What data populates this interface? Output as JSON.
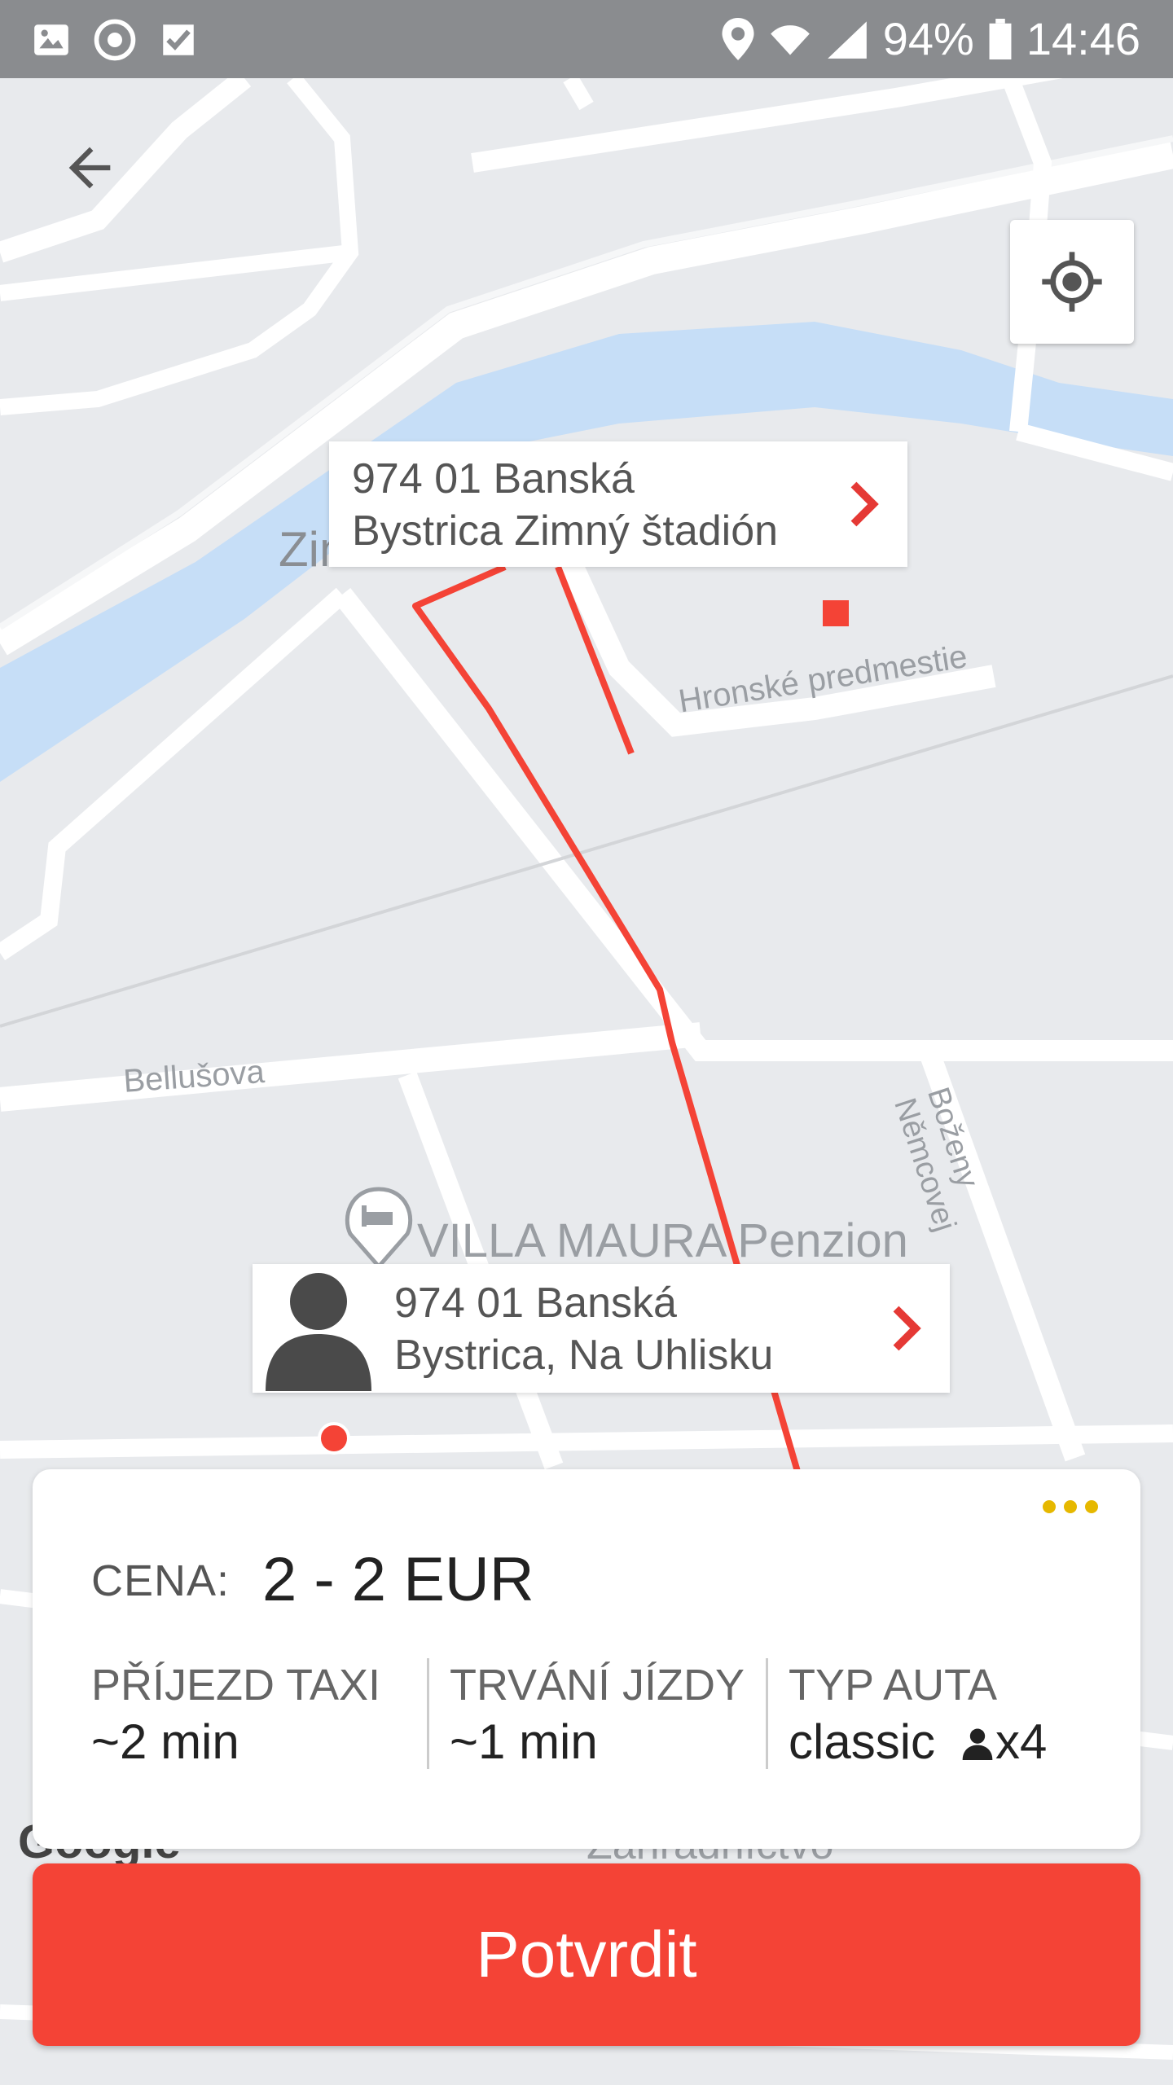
{
  "status_bar": {
    "icons_left": [
      "image-icon",
      "sync-icon",
      "task-icon"
    ],
    "icons_right": [
      "location-pin-icon",
      "wifi-icon",
      "signal-icon"
    ],
    "battery": "94%",
    "time": "14:46"
  },
  "map": {
    "labels": {
      "street_1": "Hronské predmestie",
      "street_2": "Bellušova",
      "street_3": "Boženy Němcovej",
      "poi": "VILLA MAURA Penzion",
      "partial_1": "Zim",
      "partial_2": "Google",
      "partial_3": "Záhradníctvo"
    },
    "route_color": "#f44336"
  },
  "destination": {
    "line1": "974 01 Banská",
    "line2": "Bystrica Zimný štadión"
  },
  "pickup": {
    "line1": "974 01 Banská",
    "line2": "Bystrica, Na Uhlisku"
  },
  "summary": {
    "price_label": "CENA:",
    "price_value": "2 - 2 EUR",
    "arrival_label": "PŘÍJEZD TAXI",
    "arrival_value": "~2 min",
    "duration_label": "TRVÁNÍ JÍZDY",
    "duration_value": "~1 min",
    "car_type_label": "TYP AUTA",
    "car_type_value": "classic",
    "passengers": "x4"
  },
  "confirm_button": "Potvrdit",
  "colors": {
    "accent": "#f44336",
    "menu_dots": "#e6b800",
    "river": "#c6def7",
    "map_bg": "#e8eaed"
  }
}
